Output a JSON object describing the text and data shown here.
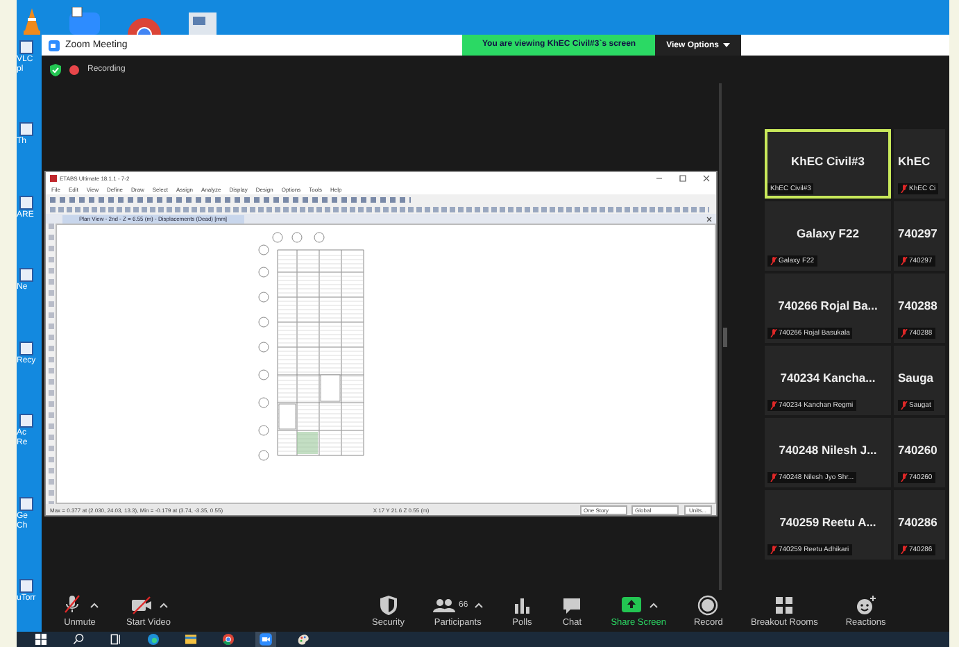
{
  "desktop": {
    "icon_groups": [
      [
        "VLC",
        "pl"
      ],
      [
        "Th"
      ],
      [
        "ARE"
      ],
      [
        "Ne"
      ],
      [
        "Recy"
      ],
      [
        "Ac",
        "Re"
      ],
      [
        "Ge",
        "Ch"
      ],
      [
        "uTorr"
      ]
    ]
  },
  "zoom_window": {
    "title": "Zoom Meeting",
    "banner": "You are viewing KhEC Civil#3`s screen",
    "view_options": "View Options",
    "recording": "Recording",
    "shared_app": {
      "title": "ETABS Ultimate 18.1.1 - 7-2",
      "menu": [
        "File",
        "Edit",
        "View",
        "Define",
        "Draw",
        "Select",
        "Assign",
        "Analyze",
        "Display",
        "Design",
        "Options",
        "Tools",
        "Help"
      ],
      "tab": "Plan View - 2nd - Z = 6.55 (m) - Displacements (Dead)  [mm]",
      "status_text": "Max = 0.377 at (2.030, 24.03, 13.3),  Min = -0.179 at (3.74, -3.35, 0.55)",
      "status_coords": "X 17  Y 21.6  Z 0.55 (m)",
      "dropdowns": [
        "One Story",
        "Global"
      ],
      "units_button": "Units..."
    },
    "gallery": [
      {
        "name": "KhEC Civil#3",
        "label": "KhEC Civil#3",
        "muted": false,
        "selected": true
      },
      {
        "name": "KhEC",
        "label": "KhEC Ci",
        "muted": true,
        "selected": false
      },
      {
        "name": "Galaxy F22",
        "label": "Galaxy F22",
        "muted": true,
        "selected": false
      },
      {
        "name": "740297",
        "label": "740297",
        "muted": true,
        "selected": false
      },
      {
        "name": "740266  Rojal Ba...",
        "label": "740266 Rojal Basukala",
        "muted": true,
        "selected": false
      },
      {
        "name": "740288",
        "label": "740288",
        "muted": true,
        "selected": false
      },
      {
        "name": "740234  Kancha...",
        "label": "740234 Kanchan Regmi",
        "muted": true,
        "selected": false
      },
      {
        "name": "Sauga",
        "label": "Saugat",
        "muted": true,
        "selected": false
      },
      {
        "name": "740248  Nilesh  J...",
        "label": "740248 Nilesh Jyo Shr...",
        "muted": true,
        "selected": false
      },
      {
        "name": "740260",
        "label": "740260",
        "muted": true,
        "selected": false
      },
      {
        "name": "740259  Reetu  A...",
        "label": "740259 Reetu Adhikari",
        "muted": true,
        "selected": false
      },
      {
        "name": "740286",
        "label": "740286",
        "muted": true,
        "selected": false
      }
    ],
    "toolbar": [
      {
        "kind": "mic",
        "label": "Unmute",
        "off": true,
        "menu": true
      },
      {
        "kind": "video",
        "label": "Start Video",
        "off": true,
        "menu": true
      },
      {
        "kind": "security",
        "label": "Security",
        "menu": false
      },
      {
        "kind": "participants",
        "label": "Participants",
        "count": "66",
        "menu": true
      },
      {
        "kind": "polls",
        "label": "Polls",
        "menu": false
      },
      {
        "kind": "chat",
        "label": "Chat",
        "menu": false
      },
      {
        "kind": "share",
        "label": "Share Screen",
        "menu": true
      },
      {
        "kind": "record",
        "label": "Record",
        "menu": false
      },
      {
        "kind": "breakout",
        "label": "Breakout Rooms",
        "menu": false
      },
      {
        "kind": "reactions",
        "label": "Reactions",
        "menu": false
      }
    ]
  },
  "taskbar": {
    "apps": [
      {
        "kind": "start",
        "active": false
      },
      {
        "kind": "search",
        "active": false
      },
      {
        "kind": "taskview",
        "active": false
      },
      {
        "kind": "edge",
        "active": false
      },
      {
        "kind": "explorer",
        "active": false
      },
      {
        "kind": "chrome",
        "active": false
      },
      {
        "kind": "zoom",
        "active": true
      },
      {
        "kind": "paint",
        "active": false
      }
    ]
  }
}
